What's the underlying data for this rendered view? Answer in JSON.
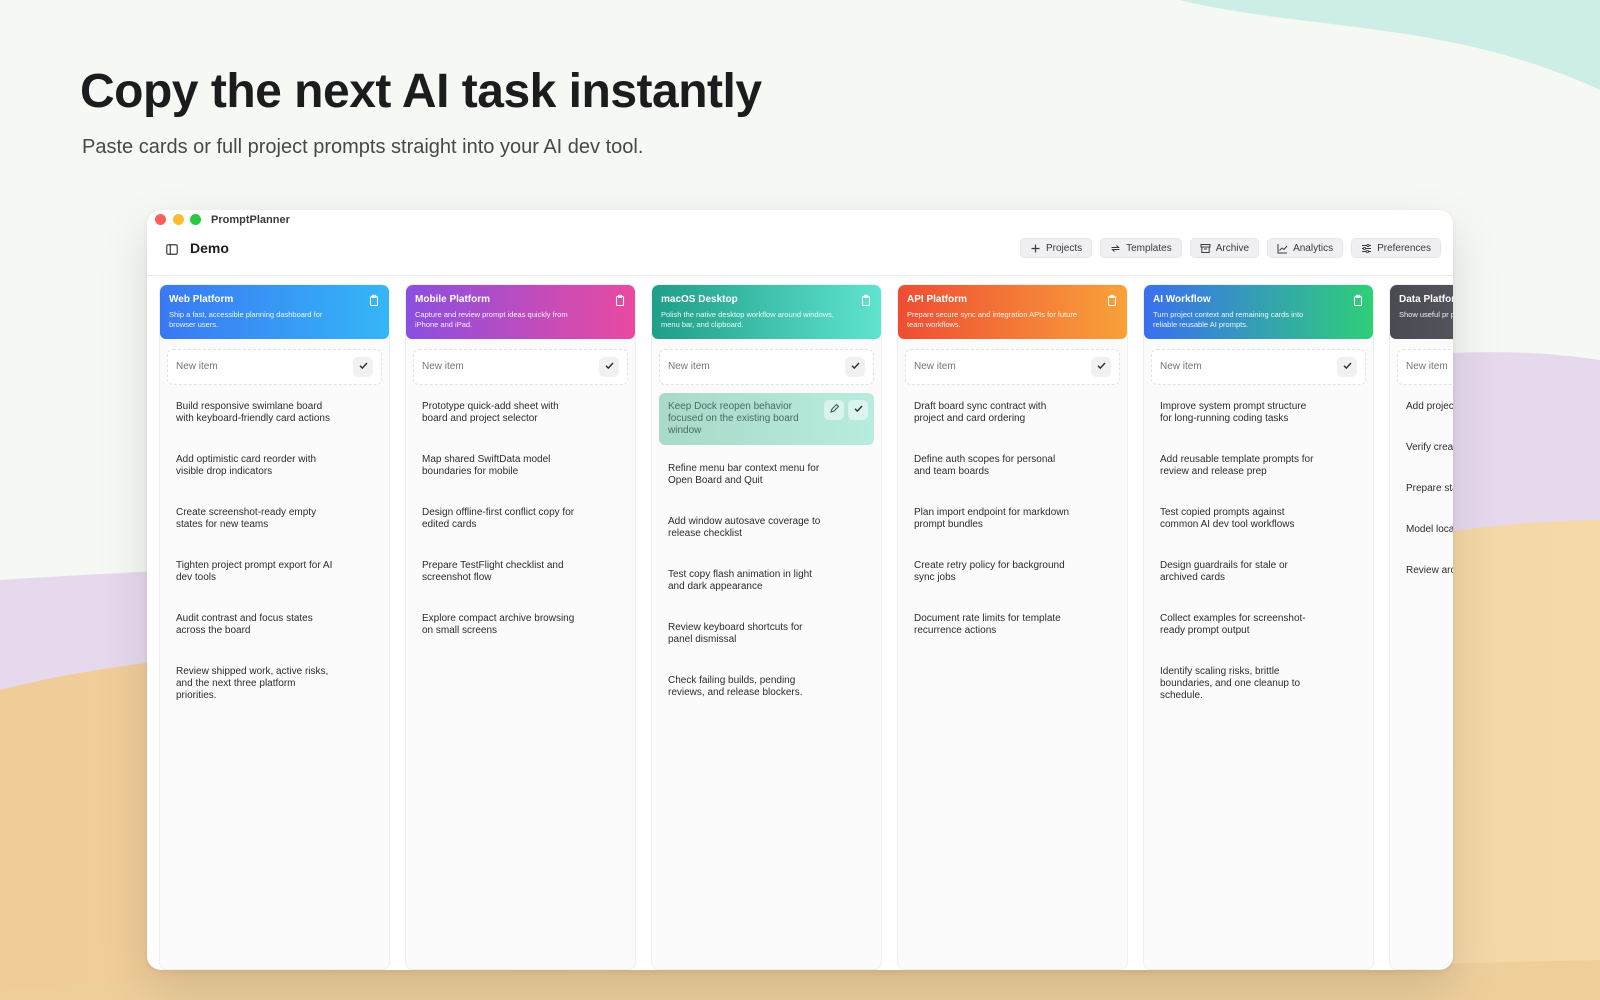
{
  "hero": {
    "title": "Copy the next AI task instantly",
    "subtitle": "Paste cards or full project prompts straight into your AI dev tool."
  },
  "window": {
    "app_name": "PromptPlanner",
    "board_title": "Demo",
    "toolbar": [
      {
        "label": "Projects",
        "icon": "plus-icon"
      },
      {
        "label": "Templates",
        "icon": "repeat-icon"
      },
      {
        "label": "Archive",
        "icon": "archive-icon"
      },
      {
        "label": "Analytics",
        "icon": "chart-icon"
      },
      {
        "label": "Preferences",
        "icon": "sliders-icon"
      }
    ]
  },
  "columns": [
    {
      "title": "Web Platform",
      "description": "Ship a fast, accessible planning dashboard for browser users.",
      "colors": [
        "#3a78f2",
        "#35b6f7"
      ],
      "new_item_placeholder": "New item",
      "cards": [
        "Build responsive swimlane board with keyboard-friendly card actions",
        "Add optimistic card reorder with visible drop indicators",
        "Create screenshot-ready empty states for new teams",
        "Tighten project prompt export for AI dev tools",
        "Audit contrast and focus states across the board",
        "Review shipped work, active risks, and the next three platform priorities."
      ]
    },
    {
      "title": "Mobile Platform",
      "description": "Capture and review prompt ideas quickly from iPhone and iPad.",
      "colors": [
        "#8a4fe0",
        "#ea4aa0"
      ],
      "new_item_placeholder": "New item",
      "cards": [
        "Prototype quick-add sheet with board and project selector",
        "Map shared SwiftData model boundaries for mobile",
        "Design offline-first conflict copy for edited cards",
        "Prepare TestFlight checklist and screenshot flow",
        "Explore compact archive browsing on small screens"
      ]
    },
    {
      "title": "macOS Desktop",
      "description": "Polish the native desktop workflow around windows, menu bar, and clipboard.",
      "colors": [
        "#1f9e89",
        "#5fe3cf"
      ],
      "new_item_placeholder": "New item",
      "highlight_card": "Keep Dock reopen behavior focused on the existing board window",
      "cards": [
        "Refine menu bar context menu for Open Board and Quit",
        "Add window autosave coverage to release checklist",
        "Test copy flash animation in light and dark appearance",
        "Review keyboard shortcuts for panel dismissal",
        "Check failing builds, pending reviews, and release blockers."
      ]
    },
    {
      "title": "API Platform",
      "description": "Prepare secure sync and integration APIs for future team workflows.",
      "colors": [
        "#ee4d34",
        "#f9a13a"
      ],
      "new_item_placeholder": "New item",
      "cards": [
        "Draft board sync contract with project and card ordering",
        "Define auth scopes for personal and team boards",
        "Plan import endpoint for markdown prompt bundles",
        "Create retry policy for background sync jobs",
        "Document rate limits for template recurrence actions"
      ]
    },
    {
      "title": "AI Workflow",
      "description": "Turn project context and remaining cards into reliable reusable AI prompts.",
      "colors": [
        "#3a6ff0",
        "#2fcf78"
      ],
      "new_item_placeholder": "New item",
      "cards": [
        "Improve system prompt structure for long-running coding tasks",
        "Add reusable template prompts for review and release prep",
        "Test copied prompts against common AI dev tool workflows",
        "Design guardrails for stale or archived cards",
        "Collect examples for screenshot-ready prompt output",
        "Identify scaling risks, brittle boundaries, and one cleanup to schedule."
      ]
    },
    {
      "title": "Data Platfor",
      "description": "Show useful pr prompt content",
      "colors": [
        "#4a4a52",
        "#6a6a72"
      ],
      "new_item_placeholder": "New item",
      "cards": [
        "Add projec for analytic",
        "Verify crea chart over",
        "Prepare sta Store scree",
        "Model loca for store su",
        "Review arc bulk compl"
      ]
    }
  ]
}
